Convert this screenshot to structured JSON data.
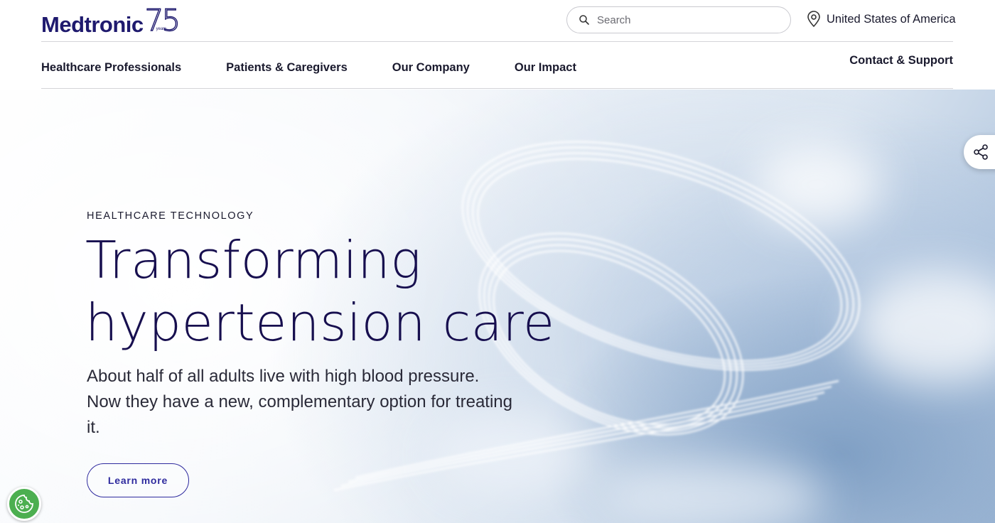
{
  "header": {
    "logo_text": "Medtronic",
    "logo_anniversary": "75",
    "logo_years": "years",
    "search": {
      "placeholder": "Search"
    },
    "locale": "United States of America"
  },
  "nav": {
    "items": [
      {
        "label": "Healthcare Professionals"
      },
      {
        "label": "Patients & Caregivers"
      },
      {
        "label": "Our Company"
      },
      {
        "label": "Our Impact"
      }
    ],
    "contact": "Contact & Support"
  },
  "hero": {
    "eyebrow": "HEALTHCARE TECHNOLOGY",
    "headline_line1": "Transforming",
    "headline_line2": "hypertension care",
    "subtext": "About half of all adults live with high blood pressure. Now they have a new, complementary option for treating it.",
    "cta_label": "Learn more"
  },
  "icons": {
    "search": "search-icon",
    "location": "location-pin-icon",
    "share": "share-icon",
    "cookie": "cookie-icon"
  },
  "colors": {
    "brand_navy": "#170f4f",
    "cta_blue": "#2e2a9e",
    "cookie_green": "#4caf50"
  }
}
